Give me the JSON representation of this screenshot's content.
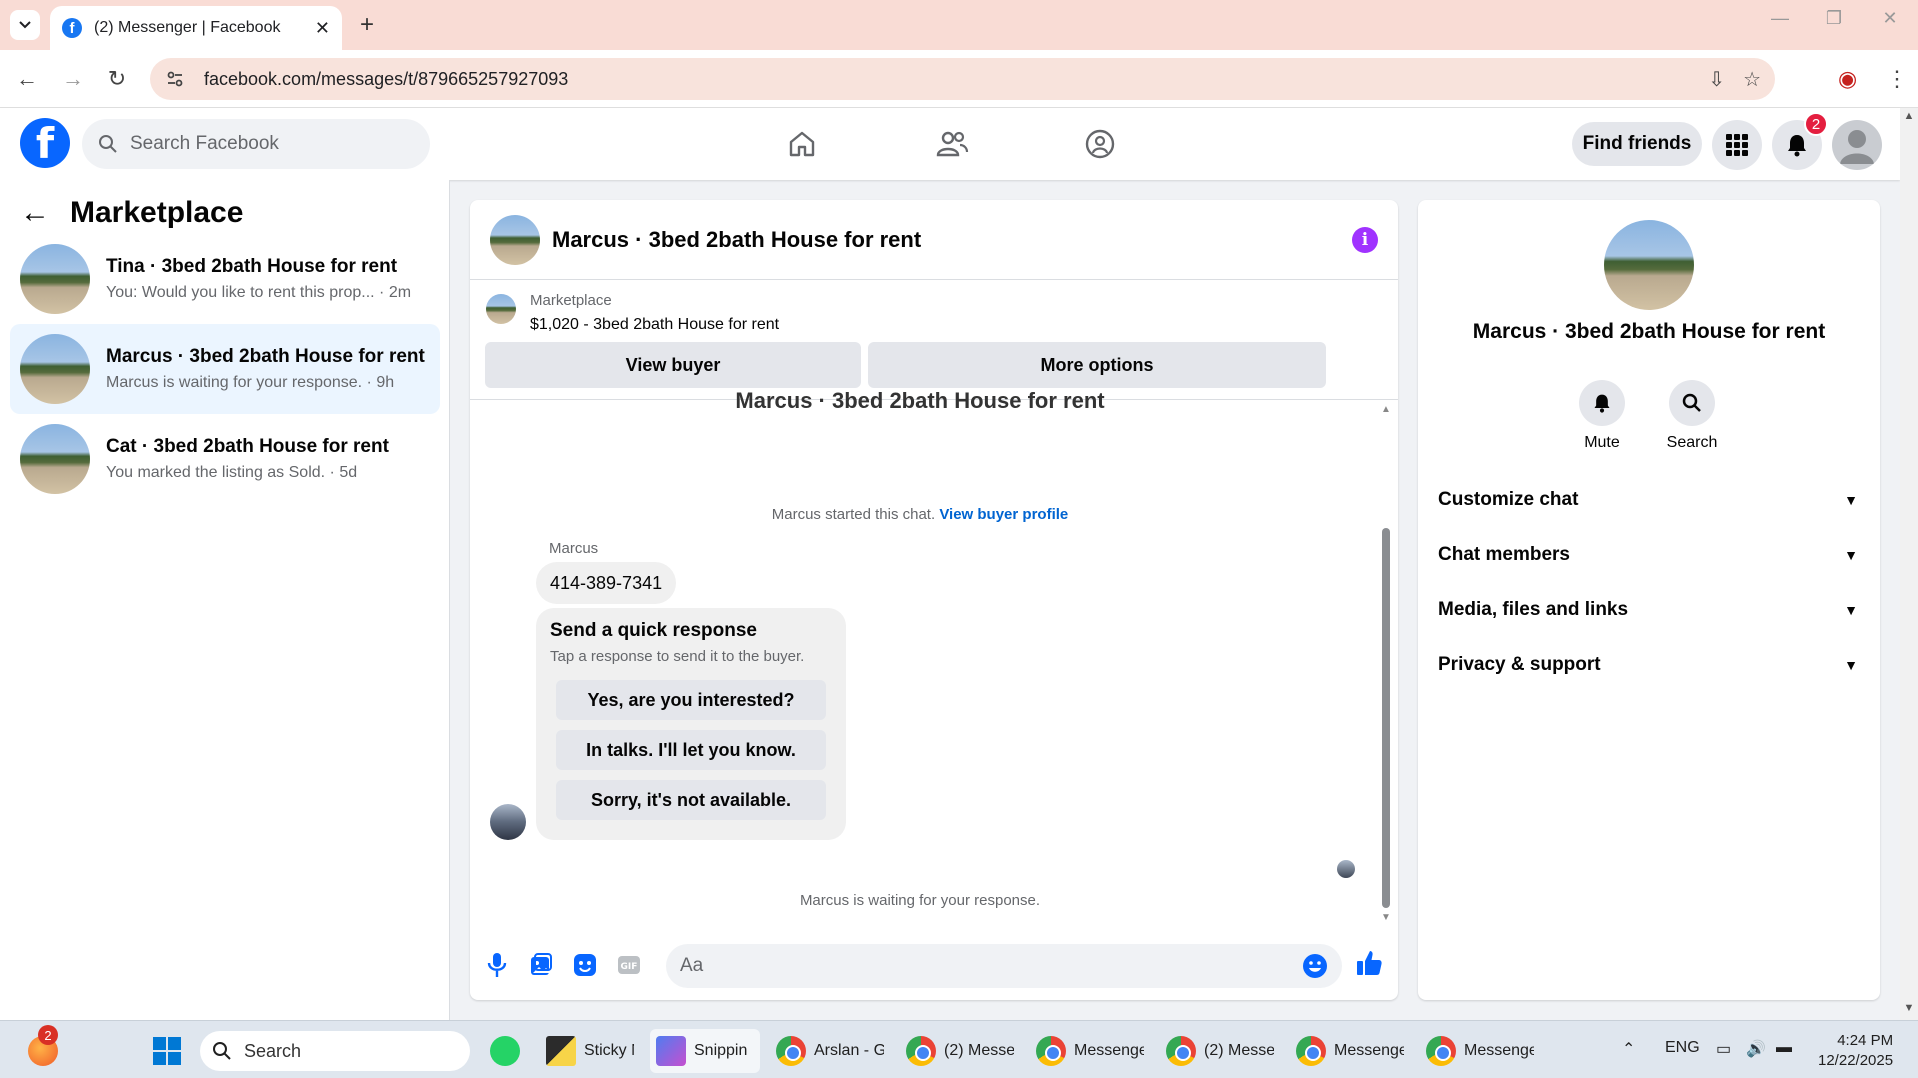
{
  "browser": {
    "tab_title": "(2) Messenger | Facebook",
    "url": "facebook.com/messages/t/879665257927093"
  },
  "fb_header": {
    "search_placeholder": "Search Facebook",
    "find_friends_label": "Find friends",
    "notification_count": "2"
  },
  "sidebar": {
    "title": "Marketplace",
    "conversations": [
      {
        "name": "Tina · 3bed 2bath House for rent",
        "preview": "You: Would you like to rent this prop... · 2m",
        "active": false
      },
      {
        "name": "Marcus · 3bed 2bath House for rent",
        "preview": "Marcus is waiting for your response. · 9h",
        "active": true
      },
      {
        "name": "Cat · 3bed 2bath House for rent",
        "preview": "You marked the listing as Sold. · 5d",
        "active": false
      }
    ]
  },
  "chat": {
    "title": "Marcus · 3bed 2bath House for rent",
    "listing_source": "Marketplace",
    "listing_price": "$1,020 - 3bed 2bath House for rent",
    "view_buyer_label": "View buyer",
    "more_options_label": "More options",
    "cut_title": "Marcus · 3bed 2bath House for rent",
    "started_text": "Marcus started this chat.",
    "view_profile_link": "View buyer profile",
    "sender_name": "Marcus",
    "phone_message": "414-389-7341",
    "quick_response_title": "Send a quick response",
    "quick_response_subtitle": "Tap a response to send it to the buyer.",
    "quick_responses": [
      "Yes, are you interested?",
      "In talks. I'll let you know.",
      "Sorry, it's not available."
    ],
    "waiting_text": "Marcus is waiting for your response.",
    "composer_placeholder": "Aa"
  },
  "details": {
    "name": "Marcus · 3bed 2bath House for rent",
    "actions": [
      "Mute",
      "Search"
    ],
    "sections": [
      "Customize chat",
      "Chat members",
      "Media, files and links",
      "Privacy & support"
    ]
  },
  "taskbar": {
    "search_placeholder": "Search",
    "notification_count": "2",
    "apps": [
      "Sticky N",
      "Snippin",
      "Arslan - G",
      "(2) Messe",
      "Messenge",
      "(2) Messe",
      "Messenge",
      "Messenge"
    ],
    "language": "ENG",
    "time": "4:24 PM",
    "date": "12/22/2025"
  }
}
